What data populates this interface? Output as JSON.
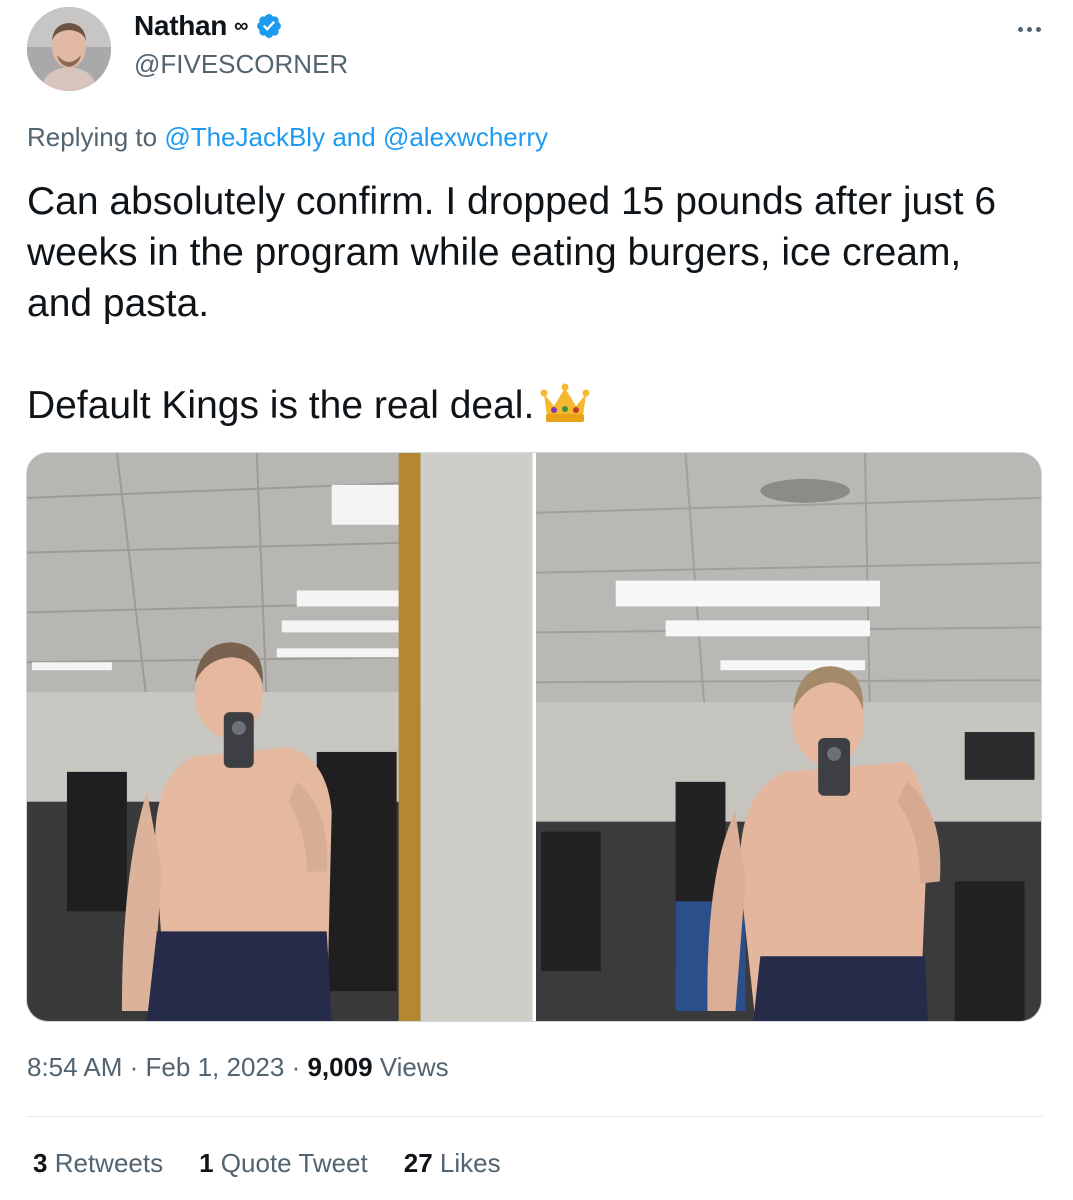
{
  "author": {
    "display_name": "Nathan",
    "name_emoji": "∞",
    "handle": "@FIVESCORNER",
    "verified": true,
    "avatar_icon": "profile-photo"
  },
  "reply": {
    "prefix": "Replying to",
    "mention_1": "@TheJackBly",
    "joiner": "and",
    "mention_2": "@alexwcherry"
  },
  "tweet": {
    "paragraph_1": "Can absolutely confirm. I dropped 15 pounds after just 6 weeks in the program while eating burgers, ice cream, and pasta.",
    "paragraph_2": "Default Kings is the real deal.",
    "emoji_icon": "crown-icon"
  },
  "media": {
    "photos": [
      {
        "icon": "gym-mirror-selfie-before"
      },
      {
        "icon": "gym-mirror-selfie-after"
      }
    ]
  },
  "meta": {
    "time": "8:54 AM",
    "separator": "·",
    "date": "Feb 1, 2023",
    "views_count": "9,009",
    "views_label": "Views"
  },
  "stats": {
    "retweets_count": "3",
    "retweets_label": "Retweets",
    "quotes_count": "1",
    "quotes_label": "Quote Tweet",
    "likes_count": "27",
    "likes_label": "Likes"
  },
  "colors": {
    "link": "#1d9bf0",
    "secondary_text": "#536471",
    "primary_text": "#0f1419",
    "verified_badge": "#1d9bf0"
  }
}
